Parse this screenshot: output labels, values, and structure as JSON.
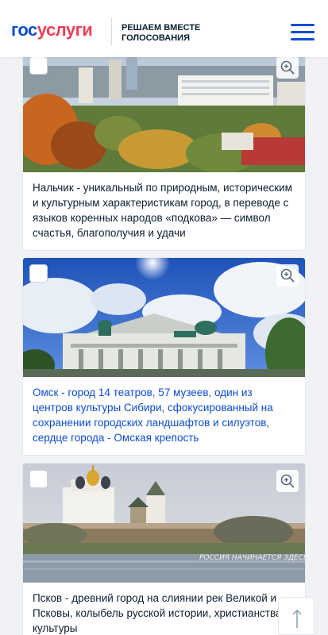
{
  "header": {
    "logo_gos": "гос",
    "logo_uslugi": "услуги",
    "tagline": "РЕШАЕМ ВМЕСТЕ ГОЛОСОВАНИЯ"
  },
  "cards": [
    {
      "caption": "Нальчик - уникальный по природным, историческим и культурным характеристикам город, в переводе с языков коренных народов «подкова» — символ счастья, благополучия и удачи",
      "selected": false
    },
    {
      "caption": "Омск - город 14 театров, 57 музеев, один из центров культуры Сибири, сфокусированный на сохранении городских ландшафтов и силуэтов, сердце города - Омская крепость",
      "selected": false
    },
    {
      "caption": "Псков - древний город на слиянии рек Великой и Псковы, колыбель русской истории, христианства и культуры",
      "selected": false,
      "photo_text": "РОССИЯ НАЧИНАЕТСЯ ЗДЕСЬ"
    }
  ],
  "icons": {
    "menu": "hamburger-icon",
    "zoom": "zoom-in-icon",
    "scroll_top": "arrow-up-icon"
  },
  "colors": {
    "brand_blue": "#0d4cd3",
    "brand_red": "#ee3f58",
    "text": "#0b1f33"
  }
}
